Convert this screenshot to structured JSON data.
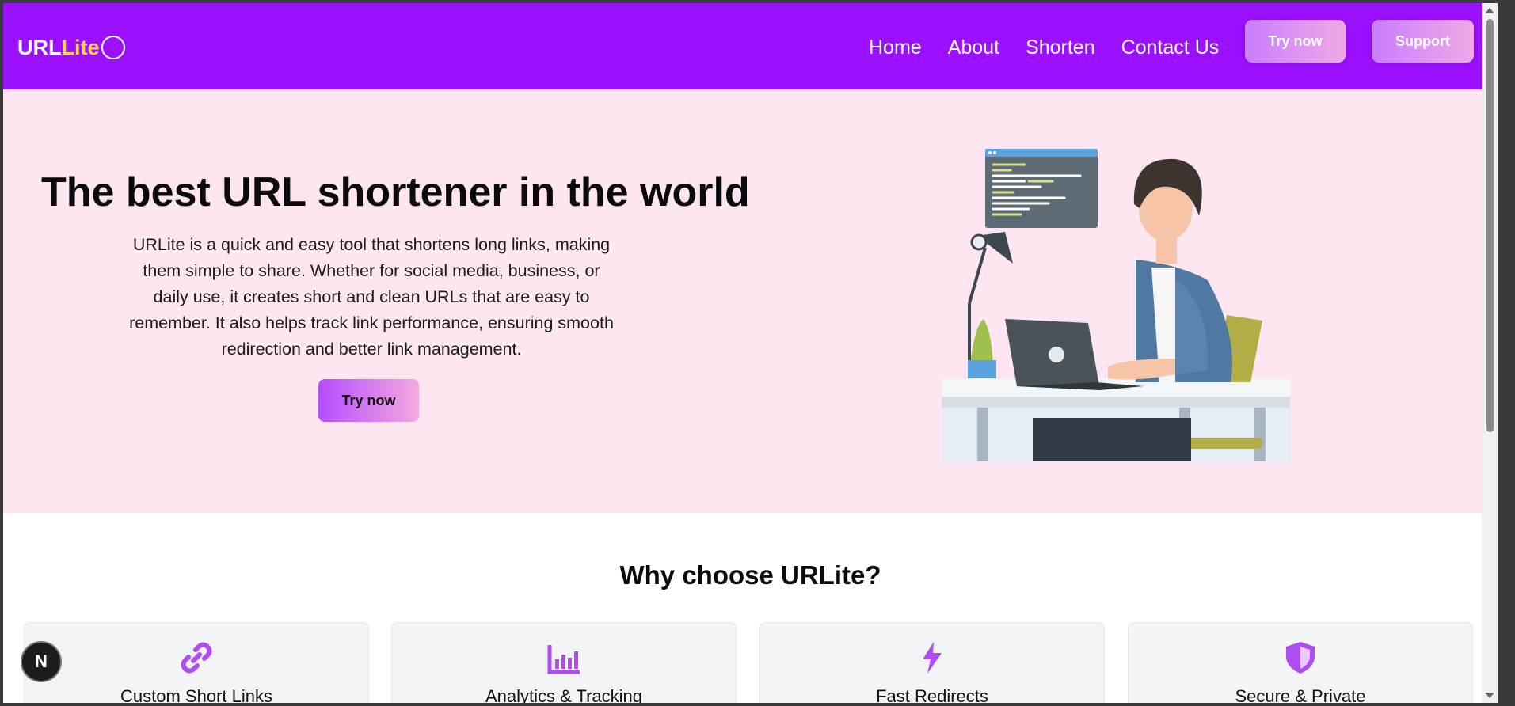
{
  "nav": {
    "logo_url": "URL",
    "logo_lite": "ite",
    "logo_L": "L",
    "links": [
      "Home",
      "About",
      "Shorten",
      "Contact Us"
    ],
    "try_now": "Try now",
    "support": "Support"
  },
  "hero": {
    "title": "The best URL shortener in the world",
    "description": "URLite is a quick and easy tool that shortens long links, making them simple to share. Whether for social media, business, or daily use, it creates short and clean URLs that are easy to remember. It also helps track link performance, ensuring smooth redirection and better link management.",
    "button": "Try now"
  },
  "features": {
    "title": "Why choose URLite?",
    "cards": [
      {
        "label": "Custom Short Links",
        "icon": "link-icon"
      },
      {
        "label": "Analytics & Tracking",
        "icon": "chart-icon"
      },
      {
        "label": "Fast Redirects",
        "icon": "lightning-icon"
      },
      {
        "label": "Secure & Private",
        "icon": "shield-icon"
      }
    ]
  },
  "badge": "N",
  "colors": {
    "nav_bg": "#9b10ff",
    "hero_bg": "#fde6f2",
    "accent": "#b44dff",
    "logo_yellow": "#ffd34d"
  }
}
